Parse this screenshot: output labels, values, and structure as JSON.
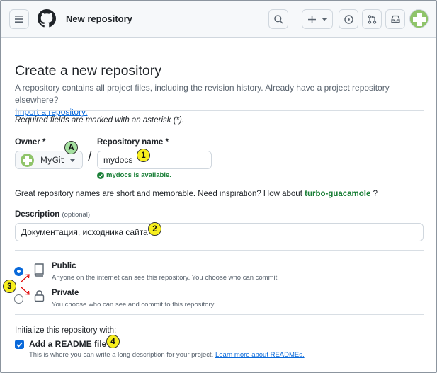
{
  "header": {
    "title": "New repository",
    "icons": [
      "hamburger-icon",
      "github-logo",
      "search-icon",
      "plus-icon",
      "chevron-down-icon",
      "issues-icon",
      "pull-request-icon",
      "inbox-icon",
      "avatar"
    ]
  },
  "page": {
    "heading": "Create a new repository",
    "subtitle": "A repository contains all project files, including the revision history. Already have a project repository elsewhere?",
    "import_link": "Import a repository.",
    "required_note": "Required fields are marked with an asterisk (*)."
  },
  "owner": {
    "label": "Owner *",
    "value": "MyGit"
  },
  "repo": {
    "label": "Repository name *",
    "value": "mydocs",
    "availability": "mydocs is available."
  },
  "hint": {
    "text": "Great repository names are short and memorable. Need inspiration? How about",
    "suggestion": "turbo-guacamole",
    "end": "?"
  },
  "description": {
    "label": "Description",
    "optional": "(optional)",
    "value": "Документация, исходника сайта"
  },
  "visibility": {
    "public": {
      "title": "Public",
      "desc": "Anyone on the internet can see this repository. You choose who can commit.",
      "selected": true
    },
    "private": {
      "title": "Private",
      "desc": "You choose who can see and commit to this repository.",
      "selected": false
    }
  },
  "init": {
    "heading": "Initialize this repository with:",
    "readme_label": "Add a README file",
    "readme_desc": "This is where you can write a long description for your project.",
    "readme_link": "Learn more about READMEs.",
    "readme_checked": true
  },
  "annotations": {
    "a": "A",
    "one": "1",
    "two": "2",
    "three": "3",
    "four": "4"
  },
  "colors": {
    "accent": "#0969da",
    "success": "#1a7f37",
    "marker_yellow": "#f7ef1e",
    "marker_green": "#a5e0a0",
    "arrow_red": "#e00000"
  }
}
